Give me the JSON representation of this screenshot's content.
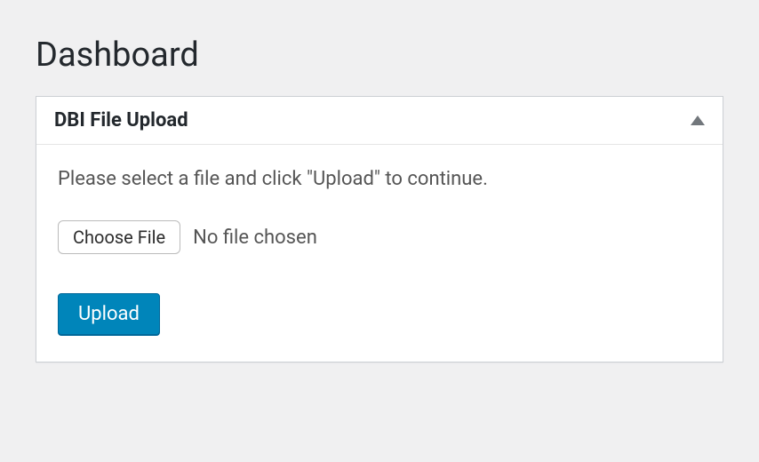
{
  "page": {
    "title": "Dashboard"
  },
  "metabox": {
    "title": "DBI File Upload",
    "instruction": "Please select a file and click \"Upload\" to continue.",
    "choose_file_label": "Choose File",
    "file_status": "No file chosen",
    "upload_label": "Upload"
  }
}
